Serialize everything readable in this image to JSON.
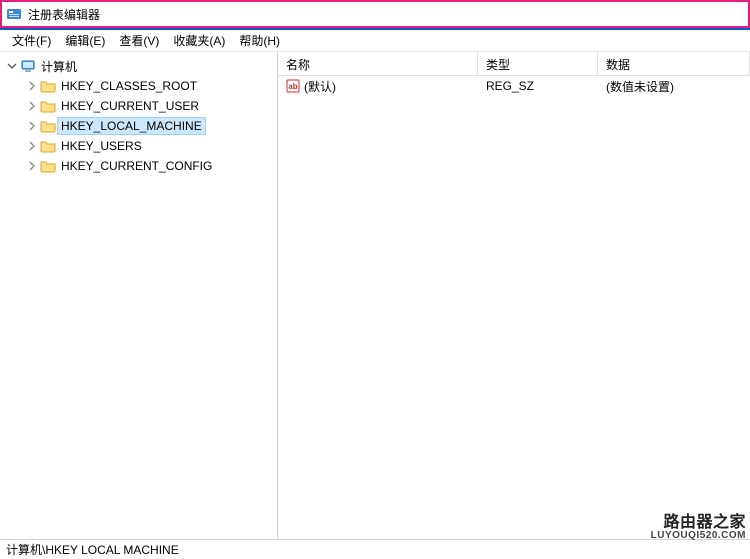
{
  "title": "注册表编辑器",
  "menu": {
    "file": "文件(F)",
    "edit": "编辑(E)",
    "view": "查看(V)",
    "favorites": "收藏夹(A)",
    "help": "帮助(H)"
  },
  "tree": {
    "root": "计算机",
    "items": [
      "HKEY_CLASSES_ROOT",
      "HKEY_CURRENT_USER",
      "HKEY_LOCAL_MACHINE",
      "HKEY_USERS",
      "HKEY_CURRENT_CONFIG"
    ],
    "selected_index": 2
  },
  "columns": {
    "name": "名称",
    "type": "类型",
    "data": "数据"
  },
  "rows": [
    {
      "icon": "string",
      "name": "(默认)",
      "type": "REG_SZ",
      "data": "(数值未设置)"
    }
  ],
  "statusbar": "计算机\\HKEY LOCAL MACHINE",
  "watermark": {
    "line1": "路由器之家",
    "line2": "LUYOUQI520.COM"
  }
}
